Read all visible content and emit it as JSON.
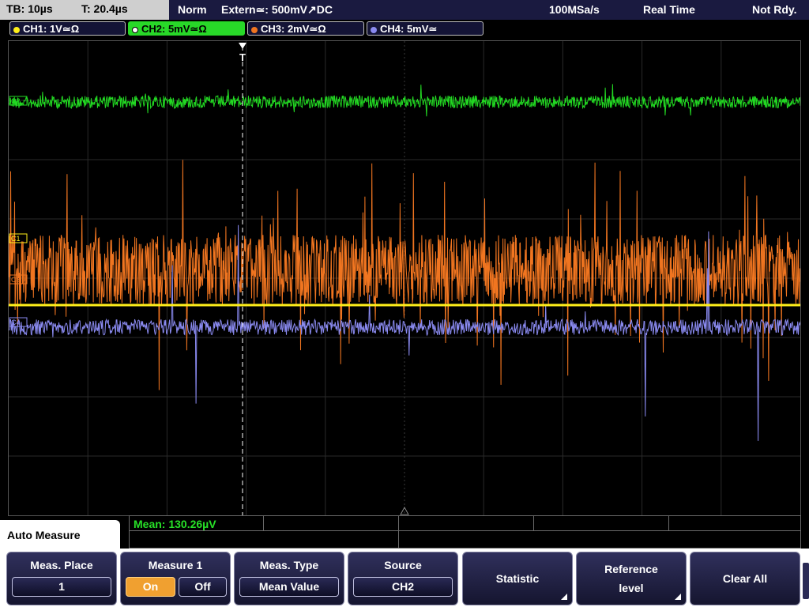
{
  "status": {
    "timebase": "TB: 10µs",
    "trigger_time": "T: 20.4µs",
    "mode": "Norm",
    "trigger_source": "Extern≃: 500mV↗DC",
    "sample_rate": "100MSa/s",
    "acq_mode": "Real Time",
    "ready": "Not Rdy."
  },
  "channels": [
    {
      "label": "CH1: 1V≃Ω",
      "color": "#ffef1a",
      "active": false
    },
    {
      "label": "CH2: 5mV≃Ω",
      "color": "#22d822",
      "active": true
    },
    {
      "label": "CH3: 2mV≃Ω",
      "color": "#f07520",
      "active": false
    },
    {
      "label": "CH4: 5mV≃",
      "color": "#8a8af0",
      "active": false
    }
  ],
  "markers": {
    "ch2": "C2",
    "ch1": "C1",
    "ch3": "C3",
    "ch4": "C4",
    "trigger": "T"
  },
  "measurement": {
    "mean": "Mean: 130.26µV"
  },
  "menu": {
    "title": "Auto Measure",
    "softkeys": {
      "meas_place": {
        "label": "Meas. Place",
        "value": "1"
      },
      "measure1": {
        "label": "Measure 1",
        "on": "On",
        "off": "Off"
      },
      "meas_type": {
        "label": "Meas. Type",
        "value": "Mean Value"
      },
      "source": {
        "label": "Source",
        "value": "CH2"
      },
      "statistic": "Statistic",
      "reference_line1": "Reference",
      "reference_line2": "level",
      "clear_all": "Clear All"
    }
  },
  "colors": {
    "ch1": "#ffef1a",
    "ch2": "#22d822",
    "ch3": "#f07520",
    "ch4": "#8a8af0",
    "on_button": "#f0a030"
  }
}
